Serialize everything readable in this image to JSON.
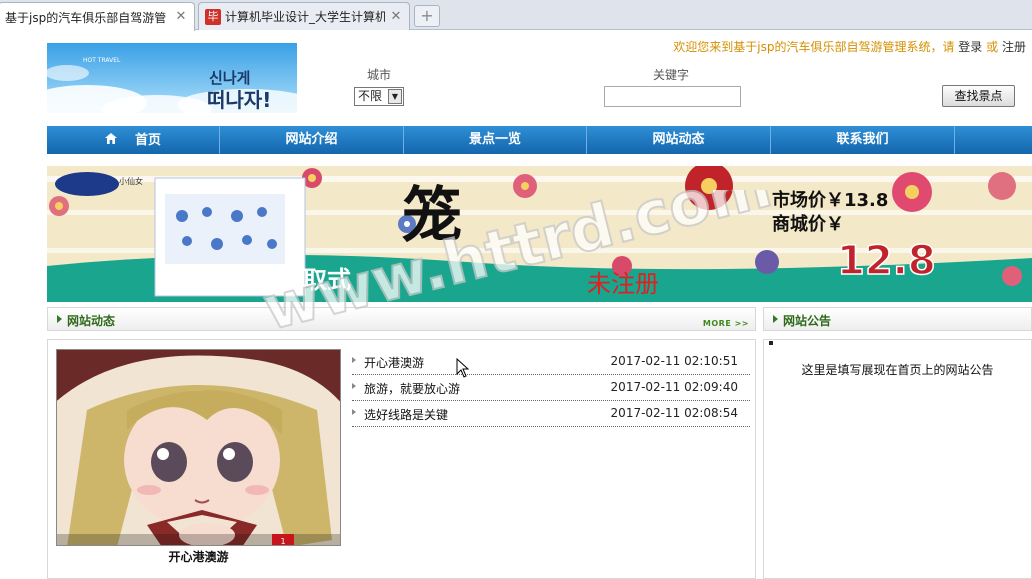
{
  "browser": {
    "tabs": [
      {
        "title": "基于jsp的汽车俱乐部自驾游管",
        "active": true
      },
      {
        "title": "计算机毕业设计_大学生计算机",
        "active": false,
        "favicon_text": "毕"
      }
    ],
    "new_tab_symbol": "+",
    "close_symbol": "✕"
  },
  "header": {
    "logo_small_text": "HOT TRAVEL",
    "logo_korean_line1": "신나게",
    "logo_korean_line2": "떠나자!",
    "welcome_text": "欢迎您来到基于jsp的汽车俱乐部自驾游管理系统，请",
    "login_link": "登录",
    "or_text": "或",
    "register_link": "注册",
    "city_label": "城市",
    "city_selected": "不限",
    "keyword_label": "关键字",
    "keyword_value": "",
    "search_button": "查找景点"
  },
  "nav": {
    "items": [
      {
        "label": "首页",
        "icon": "home-icon"
      },
      {
        "label": "网站介绍"
      },
      {
        "label": "景点一览"
      },
      {
        "label": "网站动态"
      },
      {
        "label": "联系我们"
      }
    ]
  },
  "banner": {
    "brand_text": "小仙女",
    "big_char": "笼",
    "price_line1": "市场价￥13.8",
    "price_line2": "商城价￥",
    "price_value": "12.8",
    "bottom_text": "抽取式",
    "unregistered_text": "未注册",
    "watermark": "www.httrd.com"
  },
  "news_panel": {
    "title": "网站动态",
    "more_label": "MORE >>",
    "feature_caption": "开心港澳游",
    "feature_badge": "1",
    "items": [
      {
        "title": "开心港澳游",
        "date": "2017-02-11 02:10:51"
      },
      {
        "title": "旅游，就要放心游",
        "date": "2017-02-11 02:09:40"
      },
      {
        "title": "选好线路是关键",
        "date": "2017-02-11 02:08:54"
      }
    ]
  },
  "notice_panel": {
    "title": "网站公告",
    "content": "这里是填写展现在首页上的网站公告"
  },
  "colors": {
    "nav_blue": "#1e7cc7",
    "welcome_orange": "#d49000",
    "panel_title_green": "#2e6a1a",
    "banner_teal": "#1aa58e",
    "banner_red": "#c0242a"
  }
}
